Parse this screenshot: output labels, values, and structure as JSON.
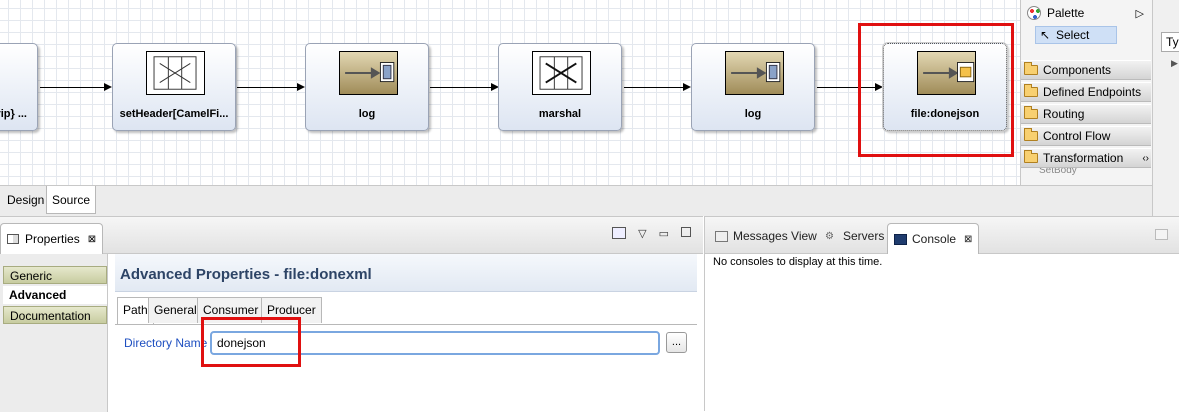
{
  "diagram": {
    "nodes": [
      {
        "label": "vip} ...",
        "icon": "endpoint-icon"
      },
      {
        "label": "setHeader[CamelFi...",
        "icon": "transform-icon"
      },
      {
        "label": "log",
        "icon": "log-endpoint-icon"
      },
      {
        "label": "marshal",
        "icon": "transform-icon"
      },
      {
        "label": "log",
        "icon": "log-endpoint-icon"
      },
      {
        "label": "file:donejson",
        "icon": "file-endpoint-icon"
      }
    ]
  },
  "palette": {
    "title": "Palette",
    "select_label": "Select",
    "drawers": [
      "Components",
      "Defined Endpoints",
      "Routing",
      "Control Flow",
      "Transformation"
    ],
    "hidden_fragment": "SetBody"
  },
  "right_edge": {
    "field_text": "Ty"
  },
  "editor_tabs": {
    "design": "Design",
    "source": "Source"
  },
  "properties": {
    "view_title": "Properties",
    "left_tabs": [
      "Generic",
      "Advanced",
      "Documentation"
    ],
    "section_title": "Advanced Properties - file:donexml",
    "sub_tabs": [
      "Path",
      "General",
      "Consumer",
      "Producer"
    ],
    "directory_label": "Directory Name",
    "directory_value": "donejson",
    "browse_label": "..."
  },
  "console_view": {
    "tabs": [
      "Messages View",
      "Servers",
      "Console"
    ],
    "message": "No consoles to display at this time."
  },
  "colors": {
    "highlight": "#e01010",
    "section_title": "#2d4466",
    "link_label": "#1e4fc0"
  }
}
